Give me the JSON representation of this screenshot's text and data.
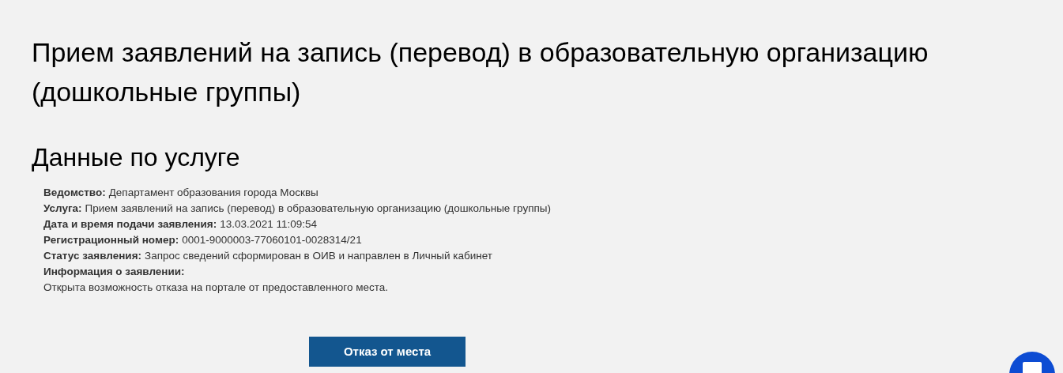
{
  "title": "Прием заявлений на запись (перевод) в образовательную организацию (дошкольные группы)",
  "section_title": "Данные по услуге",
  "details": [
    {
      "kind": "inline",
      "label": "Ведомство:",
      "value": "Департамент образования города Москвы"
    },
    {
      "kind": "inline",
      "label": "Услуга:",
      "value": "Прием заявлений на запись (перевод) в образовательную организацию (дошкольные группы)"
    },
    {
      "kind": "inline",
      "label": "Дата и время подачи заявления:",
      "value": "13.03.2021 11:09:54"
    },
    {
      "kind": "inline",
      "label": "Регистрационный номер:",
      "value": "0001-9000003-77060101-0028314/21"
    },
    {
      "kind": "inline",
      "label": "Статус заявления:",
      "value": "Запрос сведений сформирован в ОИВ и направлен в Личный кабинет"
    },
    {
      "kind": "block",
      "label": "Информация о заявлении:",
      "value": "Открыта возможность отказа на портале от предоставленного места."
    }
  ],
  "button": "Отказ от места"
}
